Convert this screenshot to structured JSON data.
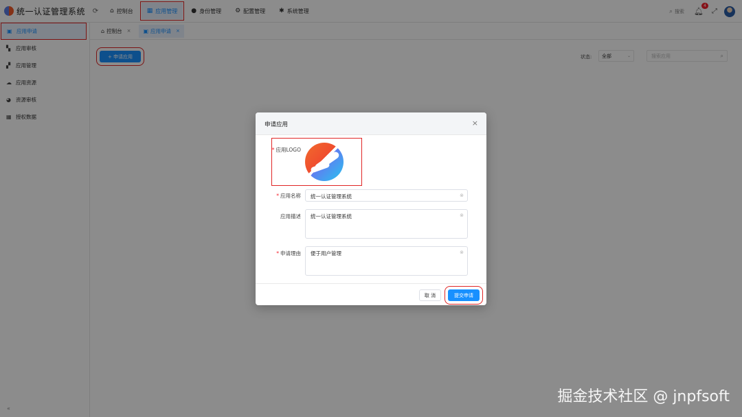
{
  "app": {
    "title": "统一认证管理系统"
  },
  "topnav": [
    {
      "label": "控制台",
      "icon": "home-icon"
    },
    {
      "label": "应用管理",
      "icon": "apps-icon"
    },
    {
      "label": "身份管理",
      "icon": "user-icon"
    },
    {
      "label": "配置管理",
      "icon": "config-icon"
    },
    {
      "label": "系统管理",
      "icon": "gear-icon"
    }
  ],
  "topright": {
    "search_label": "搜索",
    "notification_count": "4"
  },
  "sidebar": {
    "items": [
      {
        "label": "应用申请"
      },
      {
        "label": "应用审核"
      },
      {
        "label": "应用管理"
      },
      {
        "label": "应用资源"
      },
      {
        "label": "资源审核"
      },
      {
        "label": "授权数据"
      }
    ],
    "collapse_label": "«"
  },
  "tabs": [
    {
      "label": "控制台"
    },
    {
      "label": "应用申请"
    }
  ],
  "toolbar": {
    "apply_button": "+ 申请应用",
    "status_label": "状态:",
    "status_value": "全部",
    "search_placeholder": "搜索应用"
  },
  "dialog": {
    "title": "申请应用",
    "logo_label": "应用LOGO",
    "name_label": "应用名称",
    "name_value": "统一认证管理系统",
    "desc_label": "应用描述",
    "desc_value": "统一认证管理系统",
    "reason_label": "申请理由",
    "reason_value": "便于用户管理",
    "cancel_button": "取 消",
    "submit_button": "提交申请"
  },
  "watermark": "掘金技术社区 @ jnpfsoft"
}
